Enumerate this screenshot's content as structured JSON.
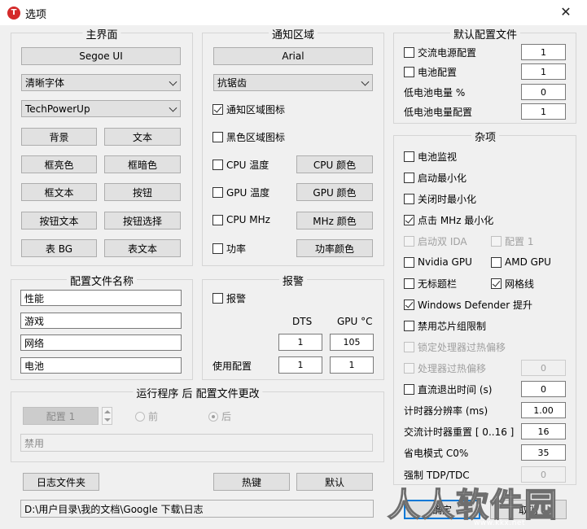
{
  "window": {
    "title": "选项",
    "app_icon_letter": "T"
  },
  "main_ui": {
    "title": "主界面",
    "font_button": "Segoe UI",
    "render_select": "清晰字体",
    "theme_select": "TechPowerUp",
    "color_buttons": [
      "背景",
      "文本",
      "框亮色",
      "框暗色",
      "框文本",
      "按钮",
      "按钮文本",
      "按钮选择",
      "表 BG",
      "表文本"
    ]
  },
  "tray": {
    "title": "通知区域",
    "font_button": "Arial",
    "aa_select": "抗锯齿",
    "tray_icon": "通知区域图标",
    "black_icon": "黑色区域图标",
    "cpu_temp": "CPU 温度",
    "cpu_color": "CPU 颜色",
    "gpu_temp": "GPU 温度",
    "gpu_color": "GPU 颜色",
    "cpu_mhz": "CPU MHz",
    "mhz_color": "MHz 颜色",
    "power": "功率",
    "power_color": "功率颜色"
  },
  "default_profile": {
    "title": "默认配置文件",
    "ac_profile": "交流电源配置",
    "ac_value": "1",
    "battery_profile": "电池配置",
    "battery_value": "1",
    "low_battery": "低电池电量 %",
    "low_battery_value": "0",
    "low_battery_profile": "低电池电量配置",
    "low_battery_profile_value": "1"
  },
  "misc": {
    "title": "杂项",
    "battery_monitor": "电池监视",
    "start_min": "启动最小化",
    "close_min": "关闭时最小化",
    "click_mhz_min": "点击 MHz 最小化",
    "start_ida": "启动双 IDA",
    "profile1": "配置 1",
    "nvidia": "Nvidia GPU",
    "amd": "AMD GPU",
    "no_titlebar": "无标题栏",
    "gridlines": "网格线",
    "windows_defender": "Windows Defender 提升",
    "chipset_limit": "禁用芯片组限制",
    "lock_offset": "锁定处理器过热偏移",
    "cpu_offset": "处理器过热偏移",
    "cpu_offset_value": "0",
    "dc_exit": "直流退出时间 (s)",
    "dc_exit_value": "0",
    "timer_res": "计时器分辨率 (ms)",
    "timer_res_value": "1.00",
    "ac_timer": "交流计时器重置 [ 0..16 ]",
    "ac_timer_value": "16",
    "power_save": "省电模式 C0%",
    "power_save_value": "35",
    "force_tdp": "强制 TDP/TDC",
    "force_tdp_value": "0"
  },
  "profile_names": {
    "title": "配置文件名称",
    "names": [
      "性能",
      "游戏",
      "网络",
      "电池"
    ]
  },
  "alarm": {
    "title": "报警",
    "alarm_check": "报警",
    "dts_header": "DTS",
    "gpu_header": "GPU °C",
    "dts_value": "1",
    "gpu_value": "105",
    "use_profile": "使用配置",
    "use_dts": "1",
    "use_gpu": "1"
  },
  "run_program": {
    "title": "运行程序 后 配置文件更改",
    "profile_button": "配置 1",
    "before": "前",
    "after": "后",
    "disabled_field": "禁用"
  },
  "footer": {
    "log_folder": "日志文件夹",
    "hotkeys": "热键",
    "default": "默认",
    "log_path": "D:\\用户目录\\我的文档\\Google 下载\\日志",
    "ok": "确定",
    "cancel": "取消"
  },
  "watermark": {
    "text": "人人软件园",
    "url": "www.kkx.net"
  }
}
